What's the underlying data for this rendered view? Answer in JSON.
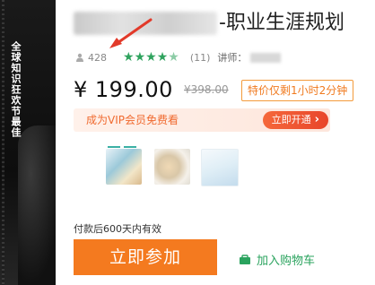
{
  "cover": {
    "vertical_text": "全球知识狂欢节最佳"
  },
  "title": {
    "suffix": "-职业生涯规划"
  },
  "stats": {
    "students": "428",
    "rating_count": "(11)",
    "teacher_label": "讲师："
  },
  "rating": {
    "stars_full": 4,
    "stars_half": 1,
    "color": "#2fa35e"
  },
  "price": {
    "current": "¥ 199.00",
    "original": "¥398.00",
    "flash_sale": "特价仅剩1小时2分钟"
  },
  "vip": {
    "text": "成为VIP会员免费看",
    "button": "立即开通",
    "chevron": "›"
  },
  "validity": "付款后600天内有效",
  "actions": {
    "join": "立即参加",
    "cart": "加入购物车"
  },
  "colors": {
    "accent_orange": "#f47a1f",
    "vip_red": "#e8452a",
    "green": "#2aa35e"
  }
}
